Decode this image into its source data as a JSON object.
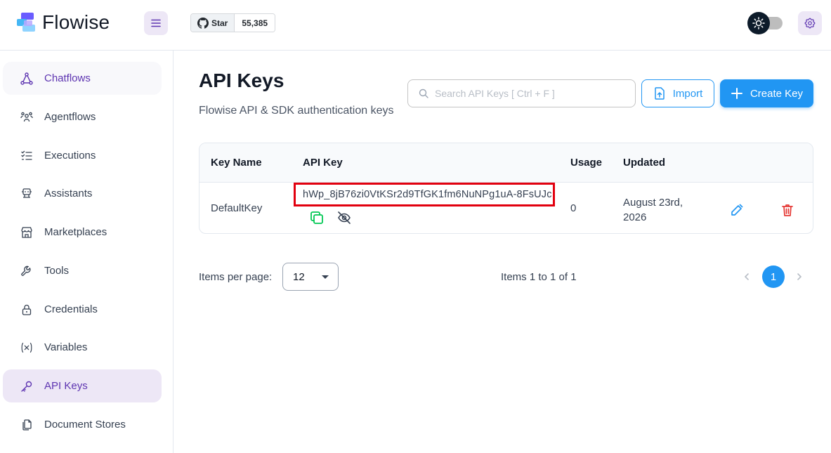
{
  "app": {
    "name": "Flowise",
    "github": {
      "star_label": "Star",
      "star_count": "55,385"
    }
  },
  "sidebar": {
    "items": [
      {
        "label": "Chatflows",
        "icon": "hierarchy-icon",
        "state": "hover"
      },
      {
        "label": "Agentflows",
        "icon": "users-group-icon"
      },
      {
        "label": "Executions",
        "icon": "list-check-icon"
      },
      {
        "label": "Assistants",
        "icon": "robot-icon"
      },
      {
        "label": "Marketplaces",
        "icon": "building-store-icon"
      },
      {
        "label": "Tools",
        "icon": "tool-icon"
      },
      {
        "label": "Credentials",
        "icon": "lock-icon"
      },
      {
        "label": "Variables",
        "icon": "variable-icon"
      },
      {
        "label": "API Keys",
        "icon": "key-icon",
        "state": "active"
      },
      {
        "label": "Document Stores",
        "icon": "files-icon"
      }
    ]
  },
  "page": {
    "title": "API Keys",
    "subtitle": "Flowise API & SDK authentication keys",
    "search_placeholder": "Search API Keys [ Ctrl + F ]",
    "import_label": "Import",
    "create_label": "Create Key"
  },
  "table": {
    "columns": [
      "Key Name",
      "API Key",
      "Usage",
      "Updated"
    ],
    "rows": [
      {
        "key_name": "DefaultKey",
        "api_key": "hWp_8jB76zi0VtKSr2d9TfGK1fm6NuNPg1uA-8FsUJc",
        "usage": "0",
        "updated_line1": "August 23rd,",
        "updated_line2": "2026"
      }
    ]
  },
  "pagination": {
    "per_page_label": "Items per page:",
    "per_page_value": "12",
    "items_info": "Items 1 to 1 of 1",
    "current_page": "1"
  },
  "colors": {
    "accent_purple": "#5e35b1",
    "accent_blue": "#2196f3",
    "danger_red": "#e53935",
    "copy_green": "#00c853",
    "highlight_red": "#e2000f"
  }
}
